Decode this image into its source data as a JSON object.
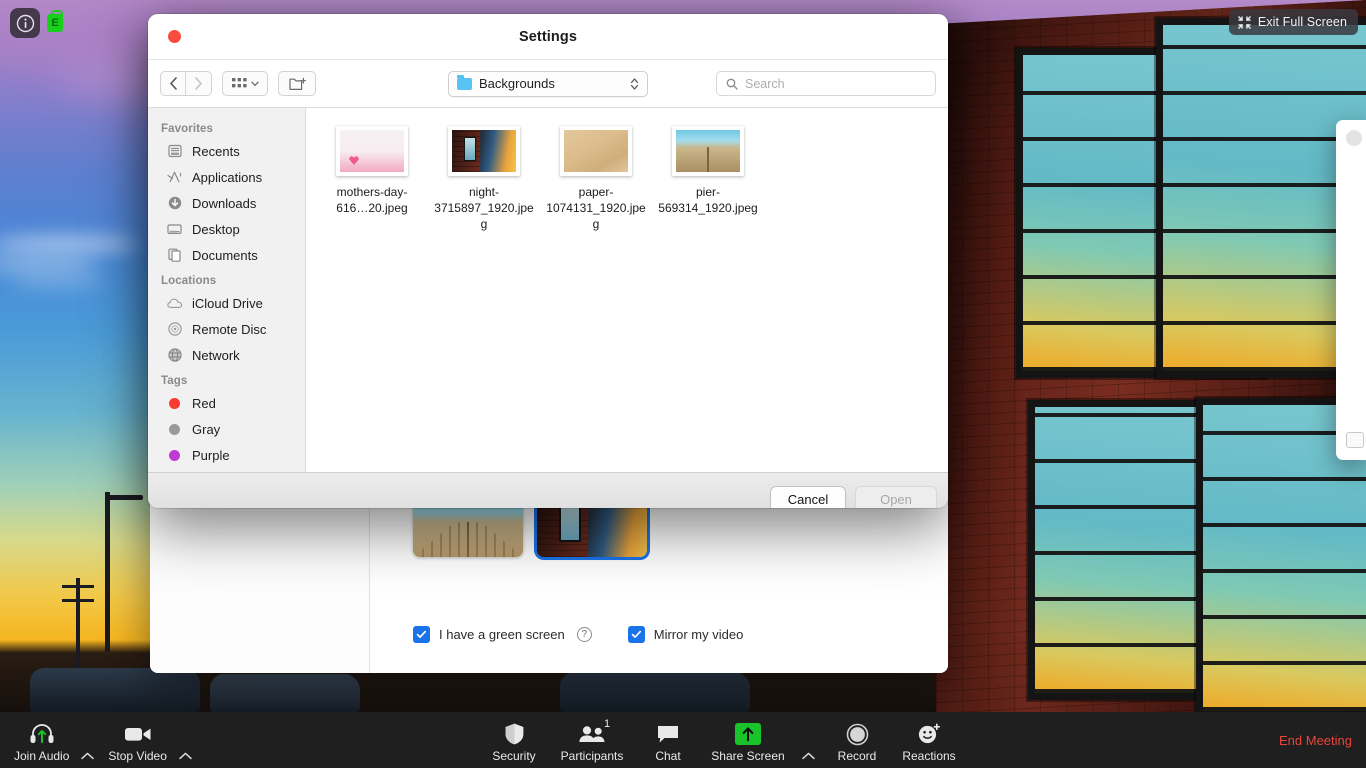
{
  "desktop": {
    "info_icon": "info-circle-icon",
    "lock_badge_text": "E",
    "exit_full_screen": "Exit Full Screen"
  },
  "dialog": {
    "title": "Settings",
    "toolbar": {
      "back_icon": "chevron-left-icon",
      "forward_icon": "chevron-right-icon",
      "view_icon": "icon-view-grid-icon",
      "view_caret_icon": "chevron-down-icon",
      "new_folder_icon": "new-folder-icon",
      "path_label": "Backgrounds",
      "path_stepper_icon": "stepper-up-down-icon",
      "search_icon": "search-icon",
      "search_placeholder": "Search",
      "search_value": ""
    },
    "sidebar": {
      "sections": [
        {
          "heading": "Favorites",
          "items": [
            {
              "label": "Recents",
              "icon": "recents-clock-icon"
            },
            {
              "label": "Applications",
              "icon": "applications-icon"
            },
            {
              "label": "Downloads",
              "icon": "downloads-arrow-icon"
            },
            {
              "label": "Desktop",
              "icon": "desktop-monitor-icon"
            },
            {
              "label": "Documents",
              "icon": "documents-pages-icon"
            }
          ]
        },
        {
          "heading": "Locations",
          "items": [
            {
              "label": "iCloud Drive",
              "icon": "cloud-icon"
            },
            {
              "label": "Remote Disc",
              "icon": "disc-icon"
            },
            {
              "label": "Network",
              "icon": "globe-icon"
            }
          ]
        },
        {
          "heading": "Tags",
          "items": [
            {
              "label": "Red",
              "icon": "tag-dot-icon",
              "color": "#f93b31"
            },
            {
              "label": "Gray",
              "icon": "tag-dot-icon",
              "color": "#9a9a9a"
            },
            {
              "label": "Purple",
              "icon": "tag-dot-icon",
              "color": "#c03ad6"
            }
          ]
        }
      ]
    },
    "files": [
      {
        "name": "mothers-day-616…20.jpeg",
        "thumb": "mothers-day-thumb"
      },
      {
        "name": "night-3715897_1920.jpeg",
        "thumb": "night-thumb"
      },
      {
        "name": "paper-1074131_1920.jpeg",
        "thumb": "paper-thumb"
      },
      {
        "name": "pier-569314_1920.jpeg",
        "thumb": "pier-thumb"
      }
    ],
    "footer": {
      "cancel_label": "Cancel",
      "open_label": "Open",
      "open_enabled": false
    }
  },
  "settings_window": {
    "backgrounds": [
      {
        "name": "pier-background-thumbnail",
        "selected": false
      },
      {
        "name": "night-background-thumbnail",
        "selected": true
      }
    ],
    "green_screen_label": "I have a green screen",
    "green_screen_checked": true,
    "help_icon_label": "?",
    "mirror_label": "Mirror my video",
    "mirror_checked": true,
    "accent_color": "#1a73e8"
  },
  "toolbar": {
    "left": [
      {
        "label": "Join Audio",
        "icon": "headset-join-audio-icon",
        "caret": true
      },
      {
        "label": "Stop Video",
        "icon": "video-camera-icon",
        "caret": true
      }
    ],
    "center": [
      {
        "label": "Security",
        "icon": "shield-icon",
        "caret": false
      },
      {
        "label": "Participants",
        "icon": "participants-people-icon",
        "caret": false,
        "badge": "1"
      },
      {
        "label": "Chat",
        "icon": "chat-bubble-icon",
        "caret": false
      },
      {
        "label": "Share Screen",
        "icon": "share-screen-up-arrow-icon",
        "caret": true
      },
      {
        "label": "Record",
        "icon": "record-circle-icon",
        "caret": false
      },
      {
        "label": "Reactions",
        "icon": "reactions-smiley-plus-icon",
        "caret": false
      }
    ],
    "end_meeting_label": "End Meeting",
    "end_meeting_color": "#e8453c",
    "share_screen_color": "#19c32a"
  }
}
